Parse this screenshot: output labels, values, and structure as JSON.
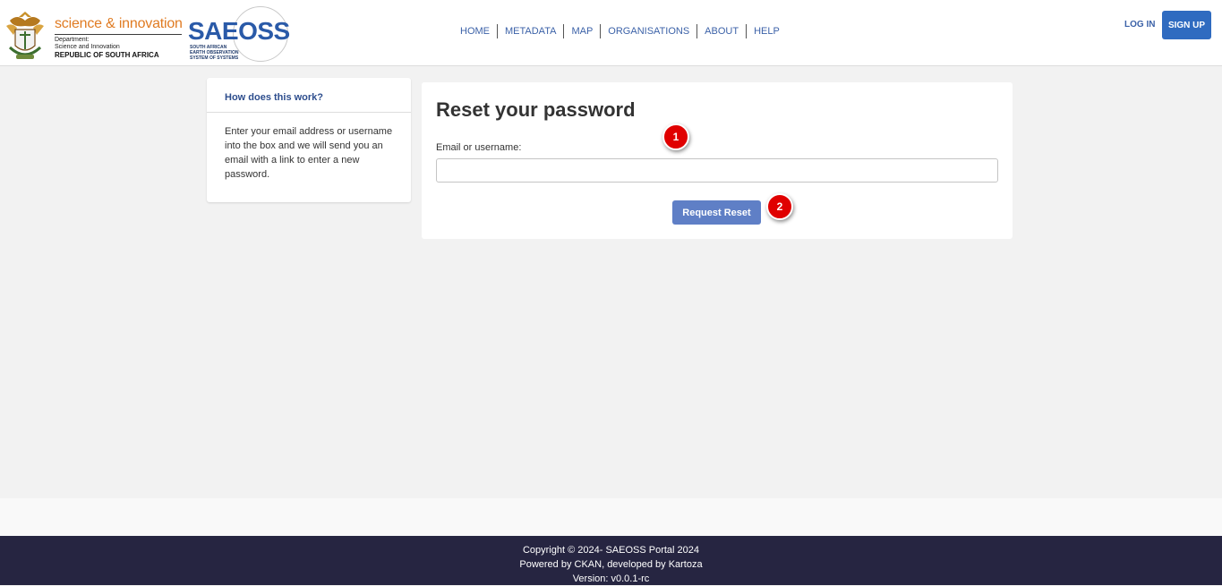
{
  "header": {
    "dsi_title": "science & innovation",
    "dsi_department": "Department:",
    "dsi_department_name": "Science and Innovation",
    "dsi_country": "REPUBLIC OF SOUTH AFRICA",
    "saeoss_word": "SAEOSS",
    "saeoss_subtitle_1": "SOUTH AFRICAN",
    "saeoss_subtitle_2": "EARTH OBSERVATION",
    "saeoss_subtitle_3": "SYSTEM OF SYSTEMS",
    "nav": [
      "HOME",
      "METADATA",
      "MAP",
      "ORGANISATIONS",
      "ABOUT",
      "HELP"
    ],
    "login_label": "LOG IN",
    "signup_label": "SIGN UP"
  },
  "sidebar": {
    "heading": "How does this work?",
    "body": "Enter your email address or username into the box and we will send you an email with a link to enter a new password."
  },
  "main": {
    "title": "Reset your password",
    "field_label": "Email or username:",
    "field_value": "",
    "button_label": "Request Reset"
  },
  "markers": [
    "1",
    "2"
  ],
  "footer": {
    "line1": "Copyright © 2024- SAEOSS Portal 2024",
    "line2": "Powered by CKAN, developed by Kartoza",
    "line3": "Version: v0.0.1-rc"
  },
  "colors": {
    "accent": "#2f6bc0",
    "button": "#5f7fc6",
    "footer": "#262541",
    "marker": "#e00000"
  }
}
